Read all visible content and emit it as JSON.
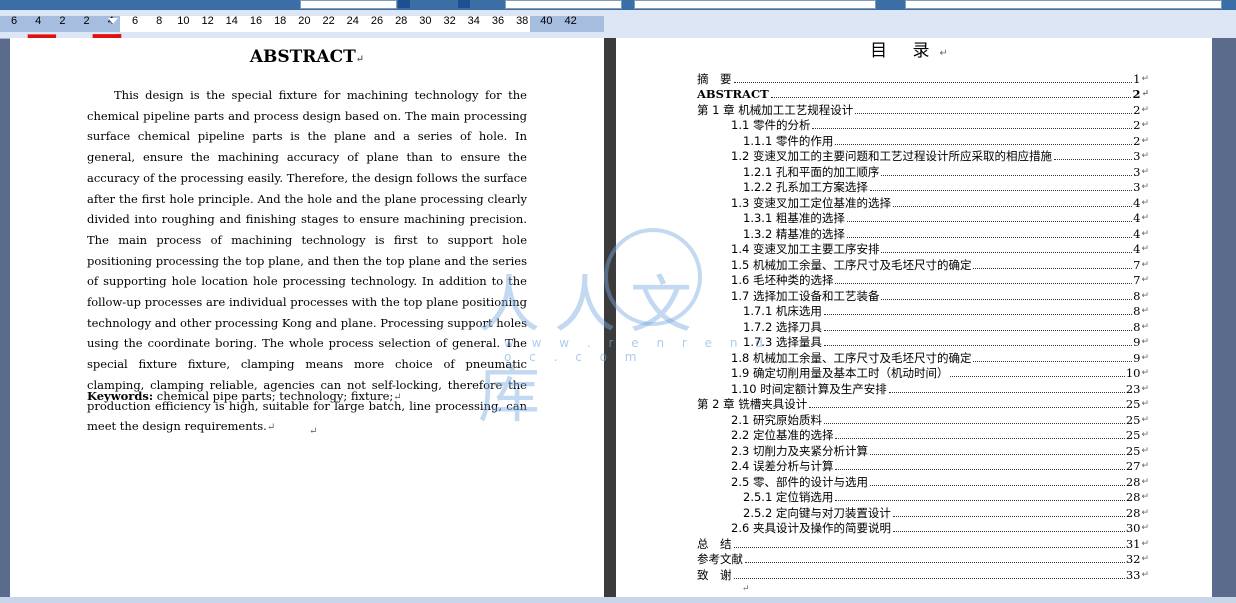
{
  "ruler": {
    "ticks": [
      "6",
      "4",
      "2",
      "2",
      "4",
      "6",
      "8",
      "10",
      "12",
      "14",
      "16",
      "18",
      "20",
      "22",
      "24",
      "26",
      "28",
      "30",
      "32",
      "34",
      "36",
      "38",
      "40",
      "42"
    ]
  },
  "watermark_ml": "目 录",
  "abstract": {
    "title": "ABSTRACT",
    "body": "This design is the special fixture for machining technology for the chemical pipeline parts and process design based on. The main processing surface chemical pipeline parts is the plane and a series of hole. In general, ensure the machining accuracy of plane than to ensure the accuracy of the processing easily. Therefore, the design follows the surface after the first hole principle. And the hole and the plane processing clearly divided into roughing and finishing stages to ensure machining precision. The main process of machining technology is first to support hole positioning processing the top plane, and then the top plane and the series of supporting hole location hole processing technology. In addition to the follow-up processes are individual processes with the top plane positioning technology and other processing Kong and plane. Processing support holes using the coordinate boring. The whole process selection of general. The special fixture fixture, clamping means more choice of pneumatic clamping, clamping reliable, agencies can not self-locking, therefore the production efficiency is high, suitable for large batch, line processing, can meet the design requirements.",
    "keywords_label": "Keywords:",
    "keywords": " chemical pipe parts; technology; fixture;"
  },
  "toc": {
    "title": "目 录",
    "entries": [
      {
        "label": "摘　要",
        "page": "1",
        "level": 0
      },
      {
        "label": "ABSTRACT",
        "page": "2",
        "level": 0,
        "bold": true
      },
      {
        "label": "第 1 章  机械加工工艺规程设计",
        "page": "2",
        "level": 0
      },
      {
        "label": "1.1  零件的分析",
        "page": "2",
        "level": 1
      },
      {
        "label": "1.1.1  零件的作用",
        "page": "2",
        "level": 2
      },
      {
        "label": "1.2  变速叉加工的主要问题和工艺过程设计所应采取的相应措施",
        "page": "3",
        "level": 1
      },
      {
        "label": "1.2.1  孔和平面的加工顺序",
        "page": "3",
        "level": 2
      },
      {
        "label": "1.2.2  孔系加工方案选择",
        "page": "3",
        "level": 2
      },
      {
        "label": "1.3  变速叉加工定位基准的选择",
        "page": "4",
        "level": 1
      },
      {
        "label": "1.3.1  粗基准的选择",
        "page": "4",
        "level": 2
      },
      {
        "label": "1.3.2  精基准的选择",
        "page": "4",
        "level": 2
      },
      {
        "label": "1.4  变速叉加工主要工序安排",
        "page": "4",
        "level": 1
      },
      {
        "label": "1.5  机械加工余量、工序尺寸及毛坯尺寸的确定",
        "page": "7",
        "level": 1
      },
      {
        "label": "1.6  毛坯种类的选择",
        "page": "7",
        "level": 1
      },
      {
        "label": "1.7  选择加工设备和工艺装备",
        "page": "8",
        "level": 1
      },
      {
        "label": "1.7.1  机床选用",
        "page": "8",
        "level": 2
      },
      {
        "label": "1.7.2  选择刀具",
        "page": "8",
        "level": 2
      },
      {
        "label": "1.7.3  选择量具",
        "page": "9",
        "level": 2
      },
      {
        "label": "1.8  机械加工余量、工序尺寸及毛坯尺寸的确定",
        "page": "9",
        "level": 1
      },
      {
        "label": "1.9 确定切削用量及基本工时（机动时间）",
        "page": "10",
        "level": 1
      },
      {
        "label": "1.10  时间定额计算及生产安排",
        "page": "23",
        "level": 1
      },
      {
        "label": "第 2 章  铣槽夹具设计",
        "page": "25",
        "level": 0
      },
      {
        "label": "2.1 研究原始质料",
        "page": "25",
        "level": 1
      },
      {
        "label": "2.2 定位基准的选择",
        "page": "25",
        "level": 1
      },
      {
        "label": "2.3  切削力及夹紧分析计算",
        "page": "25",
        "level": 1
      },
      {
        "label": "2.4  误差分析与计算",
        "page": "27",
        "level": 1
      },
      {
        "label": "2.5  零、部件的设计与选用",
        "page": "28",
        "level": 1
      },
      {
        "label": "2.5.1 定位销选用",
        "page": "28",
        "level": 2
      },
      {
        "label": "2.5.2  定向键与对刀装置设计",
        "page": "28",
        "level": 2
      },
      {
        "label": "2.6  夹具设计及操作的简要说明",
        "page": "30",
        "level": 1
      },
      {
        "label": "总　结",
        "page": "31",
        "level": 0
      },
      {
        "label": "参考文献",
        "page": "32",
        "level": 0
      },
      {
        "label": "致　谢",
        "page": "33",
        "level": 0
      }
    ]
  },
  "watermark": {
    "text": "人人文库",
    "url": "w w w . r e n r e n d o c . c o m"
  },
  "para_mark": "↵"
}
